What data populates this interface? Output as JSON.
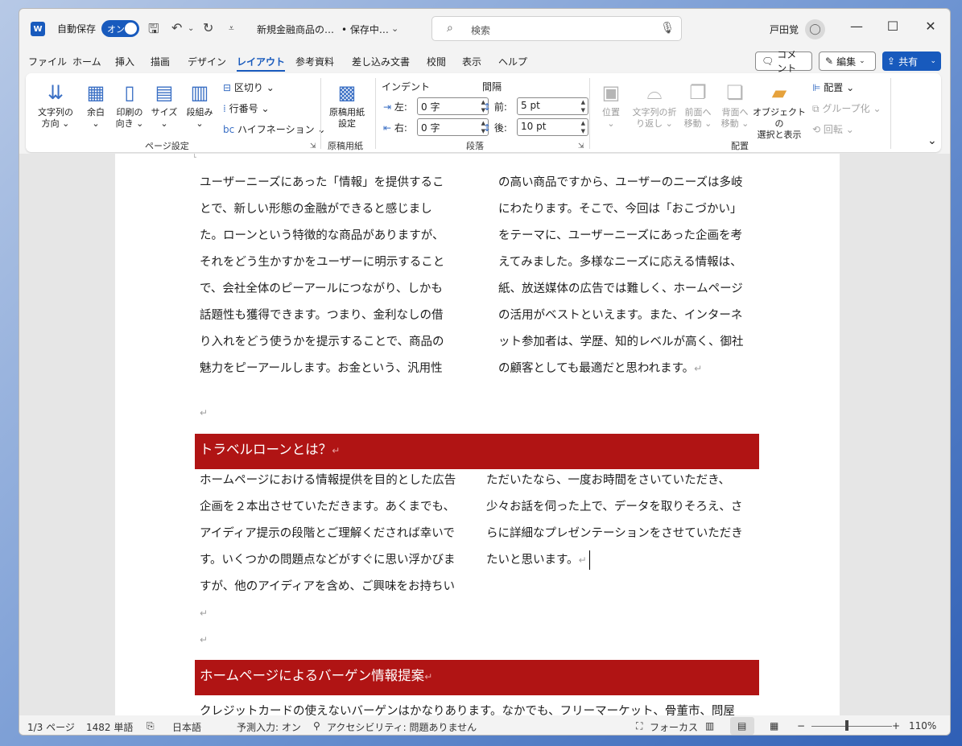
{
  "titlebar": {
    "app_icon": "W",
    "autosave_label": "自動保存",
    "autosave_toggle": "オン",
    "doc_title": "新規金融商品の…",
    "doc_status": "• 保存中…",
    "search_placeholder": "検索",
    "user_name": "戸田覚",
    "icons": [
      "save-icon",
      "undo-icon",
      "redo-icon",
      "customize-qat-icon",
      "search-icon",
      "microphone-icon",
      "user-avatar-icon",
      "minimize-icon",
      "maximize-icon",
      "close-icon"
    ]
  },
  "tabs": [
    "ファイル",
    "ホーム",
    "挿入",
    "描画",
    "デザイン",
    "レイアウト",
    "参考資料",
    "差し込み文書",
    "校閲",
    "表示",
    "ヘルプ"
  ],
  "active_tab": "レイアウト",
  "tab_right": {
    "comment": "コメント",
    "edit": "編集",
    "share": "共有"
  },
  "ribbon": {
    "page_setup": {
      "label": "ページ設定",
      "text_direction": [
        "文字列の",
        "方向"
      ],
      "margins": "余白",
      "orientation": [
        "印刷の",
        "向き"
      ],
      "size": "サイズ",
      "columns": "段組み",
      "breaks": "区切り",
      "line_numbers": "行番号",
      "hyphenation": "ハイフネーション"
    },
    "manuscript": {
      "label": "原稿用紙",
      "settings": [
        "原稿用紙",
        "設定"
      ]
    },
    "paragraph": {
      "label": "段落",
      "indent_title": "インデント",
      "spacing_title": "間隔",
      "left_label": "左:",
      "left_value": "0 字",
      "right_label": "右:",
      "right_value": "0 字",
      "before_label": "前:",
      "before_value": "5 pt",
      "after_label": "後:",
      "after_value": "10 pt"
    },
    "arrange": {
      "label": "配置",
      "position": "位置",
      "wrap_text": [
        "文字列の折",
        "り返し"
      ],
      "bring_forward": [
        "前面へ",
        "移動"
      ],
      "send_backward": [
        "背面へ",
        "移動"
      ],
      "selection_pane": [
        "オブジェクトの",
        "選択と表示"
      ],
      "align": "配置",
      "group": "グループ化",
      "rotate": "回転"
    }
  },
  "document": {
    "section1_left": [
      "ユーザーニーズにあった「情報」を提供するこ",
      "とで、新しい形態の金融ができると感じまし",
      "た。ローンという特徴的な商品がありますが、",
      "それをどう生かすかをユーザーに明示すること",
      "で、会社全体のピーアールにつながり、しかも",
      "話題性も獲得できます。つまり、金利なしの借",
      "り入れをどう使うかを提示することで、商品の",
      "魅力をピーアールします。お金という、汎用性"
    ],
    "section1_right": [
      "の高い商品ですから、ユーザーのニーズは多岐",
      "にわたります。そこで、今回は「おこづかい」",
      "をテーマに、ユーザーニーズにあった企画を考",
      "えてみました。多様なニーズに応える情報は、",
      "紙、放送媒体の広告では難しく、ホームページ",
      "の活用がベストといえます。また、インターネ",
      "ット参加者は、学歴、知的レベルが高く、御社",
      "の顧客としても最適だと思われます。"
    ],
    "heading1": "トラベルローンとは？",
    "section2_left": [
      "ホームページにおける情報提供を目的とした広告",
      "企画を２本出させていただきます。あくまでも、",
      "アイディア提示の段階とご理解くだされば幸いで",
      "す。いくつかの問題点などがすぐに思い浮かびま",
      "すが、他のアイディアを含め、ご興味をお持ちい"
    ],
    "section2_right": [
      "ただいたなら、一度お時間をさいていただき、",
      "少々お話を伺った上で、データを取りそろえ、さ",
      "らに詳細なプレゼンテーションをさせていただき",
      "たいと思います。"
    ],
    "heading2": "ホームページによるバーゲン情報提案",
    "section3_line": "クレジットカードの使えないバーゲンはかなりあります。なかでも、フリーマーケット、骨董市、問屋",
    "paragraph_mark": "↵"
  },
  "statusbar": {
    "page": "1/3 ページ",
    "words": "1482 単語",
    "language": "日本語",
    "prediction": "予測入力: オン",
    "accessibility": "アクセシビリティ: 問題ありません",
    "focus": "フォーカス",
    "zoom": "110%",
    "zoom_level": 0.5
  },
  "colors": {
    "accent": "#185abd",
    "heading_bg": "#b01414"
  }
}
